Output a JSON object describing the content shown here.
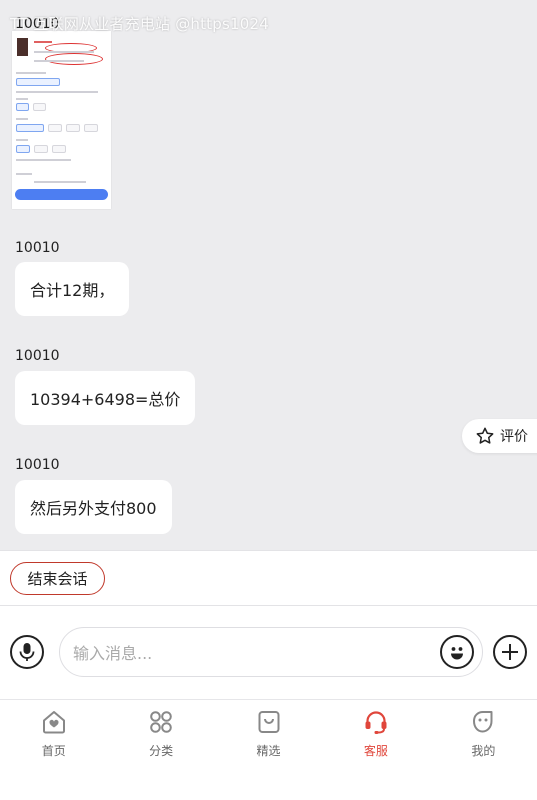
{
  "watermark": "TT 互联网从业者充电站 @https1024",
  "messages": [
    {
      "sender": "10010",
      "kind": "image"
    },
    {
      "sender": "10010",
      "text": "合计12期，"
    },
    {
      "sender": "10010",
      "text": "10394+6498=总价"
    },
    {
      "sender": "10010",
      "text": "然后另外支付800"
    }
  ],
  "rate_button": {
    "label": "评价",
    "icon": "star-outline-icon"
  },
  "end_session": {
    "label": "结束会话",
    "border_color": "#c0392b"
  },
  "composer": {
    "placeholder": "输入消息...",
    "voice_icon": "microphone-icon",
    "emoji_icon": "smiley-icon",
    "add_icon": "plus-circle-icon"
  },
  "tabbar": {
    "active_color": "#e0463b",
    "items": [
      {
        "label": "首页",
        "icon": "home-heart-icon"
      },
      {
        "label": "分类",
        "icon": "grid-four-icon"
      },
      {
        "label": "精选",
        "icon": "shopping-bag-icon"
      },
      {
        "label": "客服",
        "icon": "headset-icon",
        "active": true
      },
      {
        "label": "我的",
        "icon": "face-icon"
      }
    ]
  }
}
